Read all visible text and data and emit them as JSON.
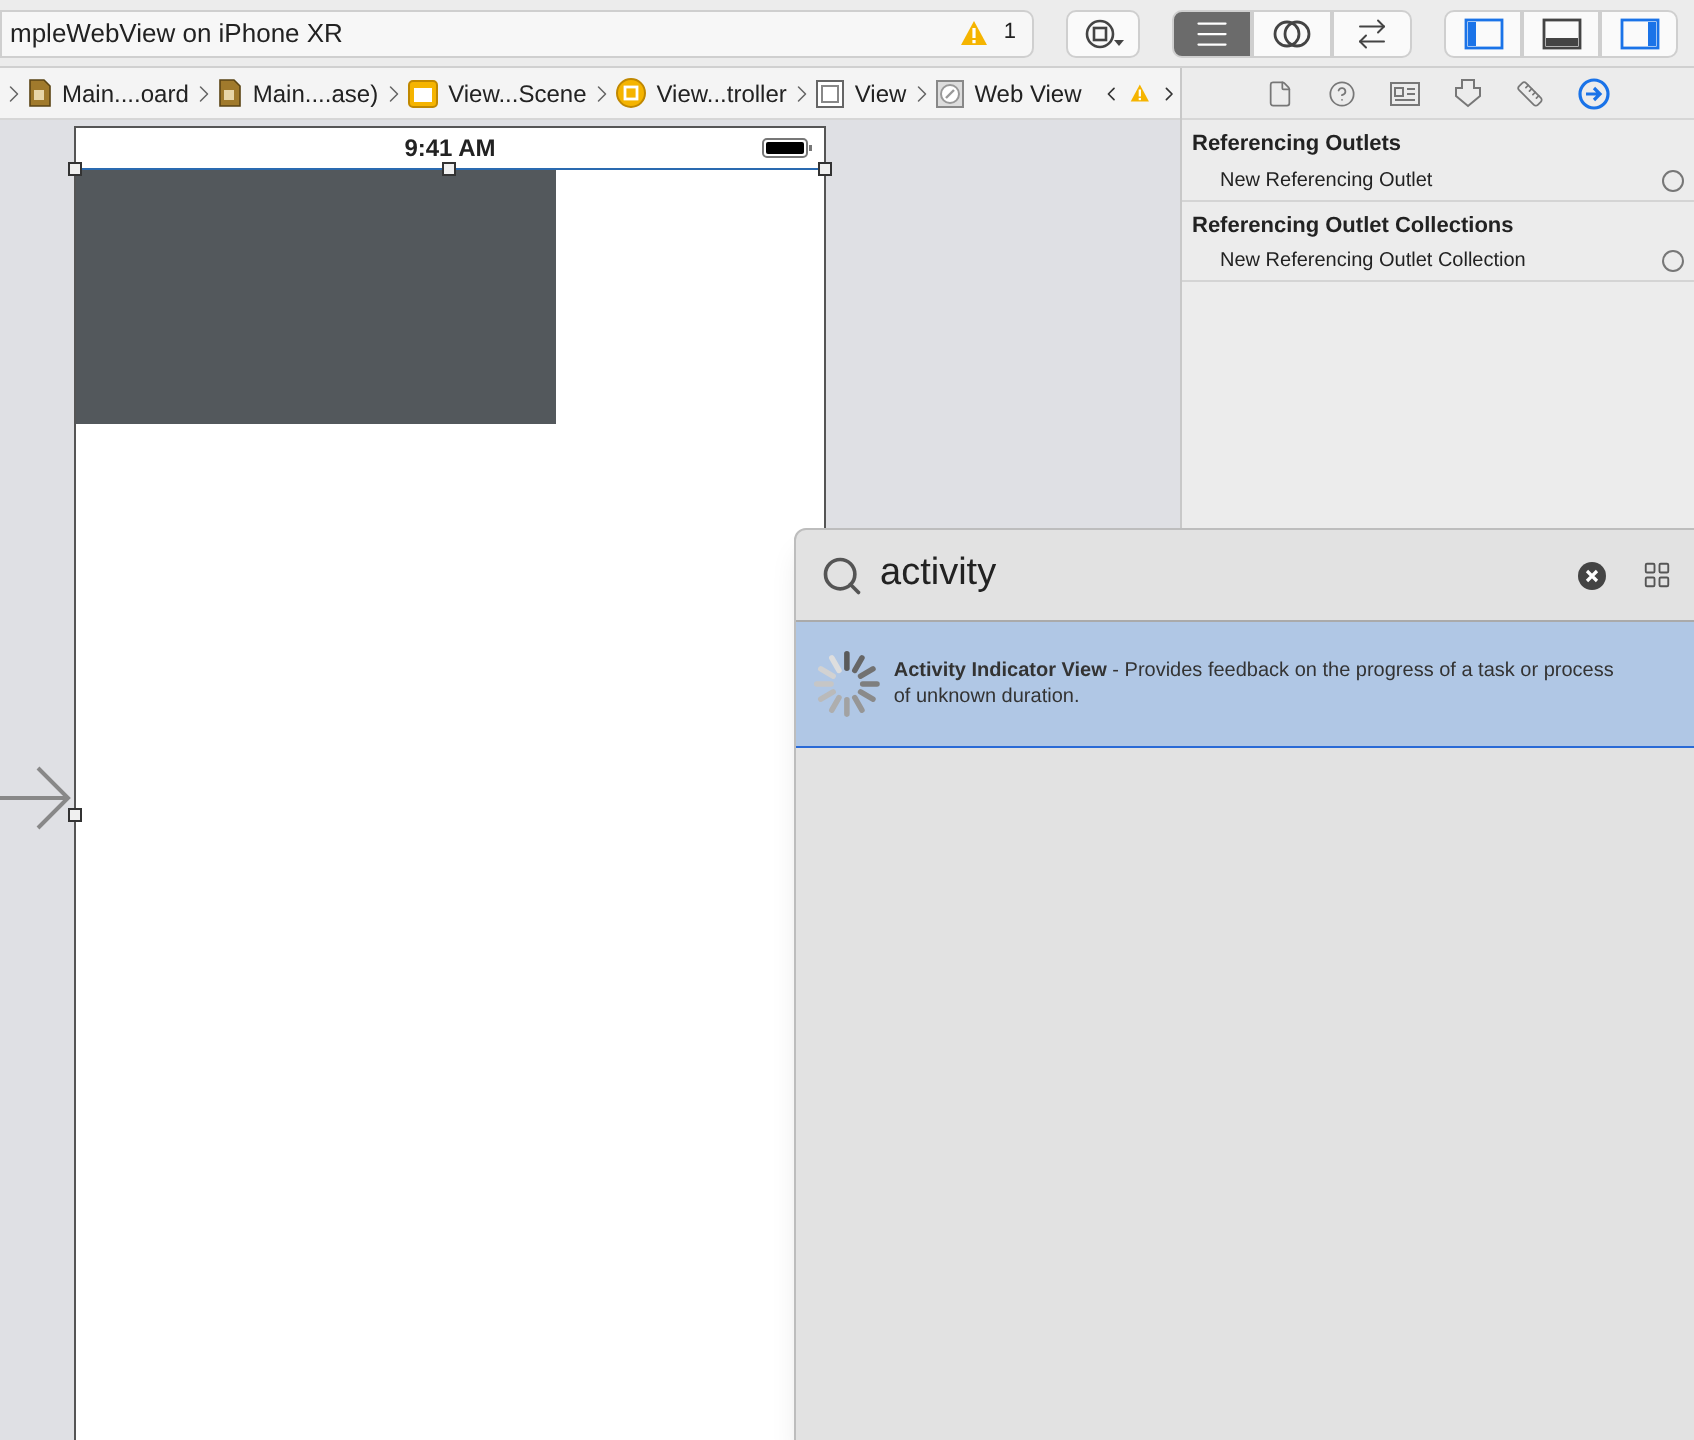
{
  "toolbar": {
    "scheme": "mpleWebView on iPhone XR",
    "warning_count": "1",
    "editor_modes": [
      {
        "kind": "standard",
        "selected": true
      },
      {
        "kind": "assistant",
        "selected": false
      },
      {
        "kind": "version",
        "selected": false
      }
    ],
    "panels": [
      {
        "kind": "navigator",
        "on": true
      },
      {
        "kind": "debug",
        "on": false
      },
      {
        "kind": "inspector",
        "on": true
      }
    ]
  },
  "breadcrumb": [
    {
      "kind": "storyboard",
      "label": "Main....oard"
    },
    {
      "kind": "storyboard",
      "label": "Main....ase)"
    },
    {
      "kind": "scene",
      "label": "View...Scene"
    },
    {
      "kind": "controller",
      "label": "View...troller"
    },
    {
      "kind": "view",
      "label": "View"
    },
    {
      "kind": "webview",
      "label": "Web View"
    }
  ],
  "canvas": {
    "status_time": "9:41 AM"
  },
  "inspector": {
    "tabs": [
      {
        "kind": "file",
        "selected": false
      },
      {
        "kind": "help",
        "selected": false
      },
      {
        "kind": "identity",
        "selected": false
      },
      {
        "kind": "attributes",
        "selected": false
      },
      {
        "kind": "size",
        "selected": false
      },
      {
        "kind": "connections",
        "selected": true
      }
    ],
    "sections": [
      {
        "title": "Referencing Outlets",
        "items": [
          {
            "label": "New Referencing Outlet"
          }
        ]
      },
      {
        "title": "Referencing Outlet Collections",
        "items": [
          {
            "label": "New Referencing Outlet Collection"
          }
        ]
      }
    ]
  },
  "library": {
    "search_value": "activity",
    "results": [
      {
        "text": "**Activity Indicator View** - Provides feedback on the progress of a task or process of unknown duration.",
        "selected": true
      }
    ]
  }
}
